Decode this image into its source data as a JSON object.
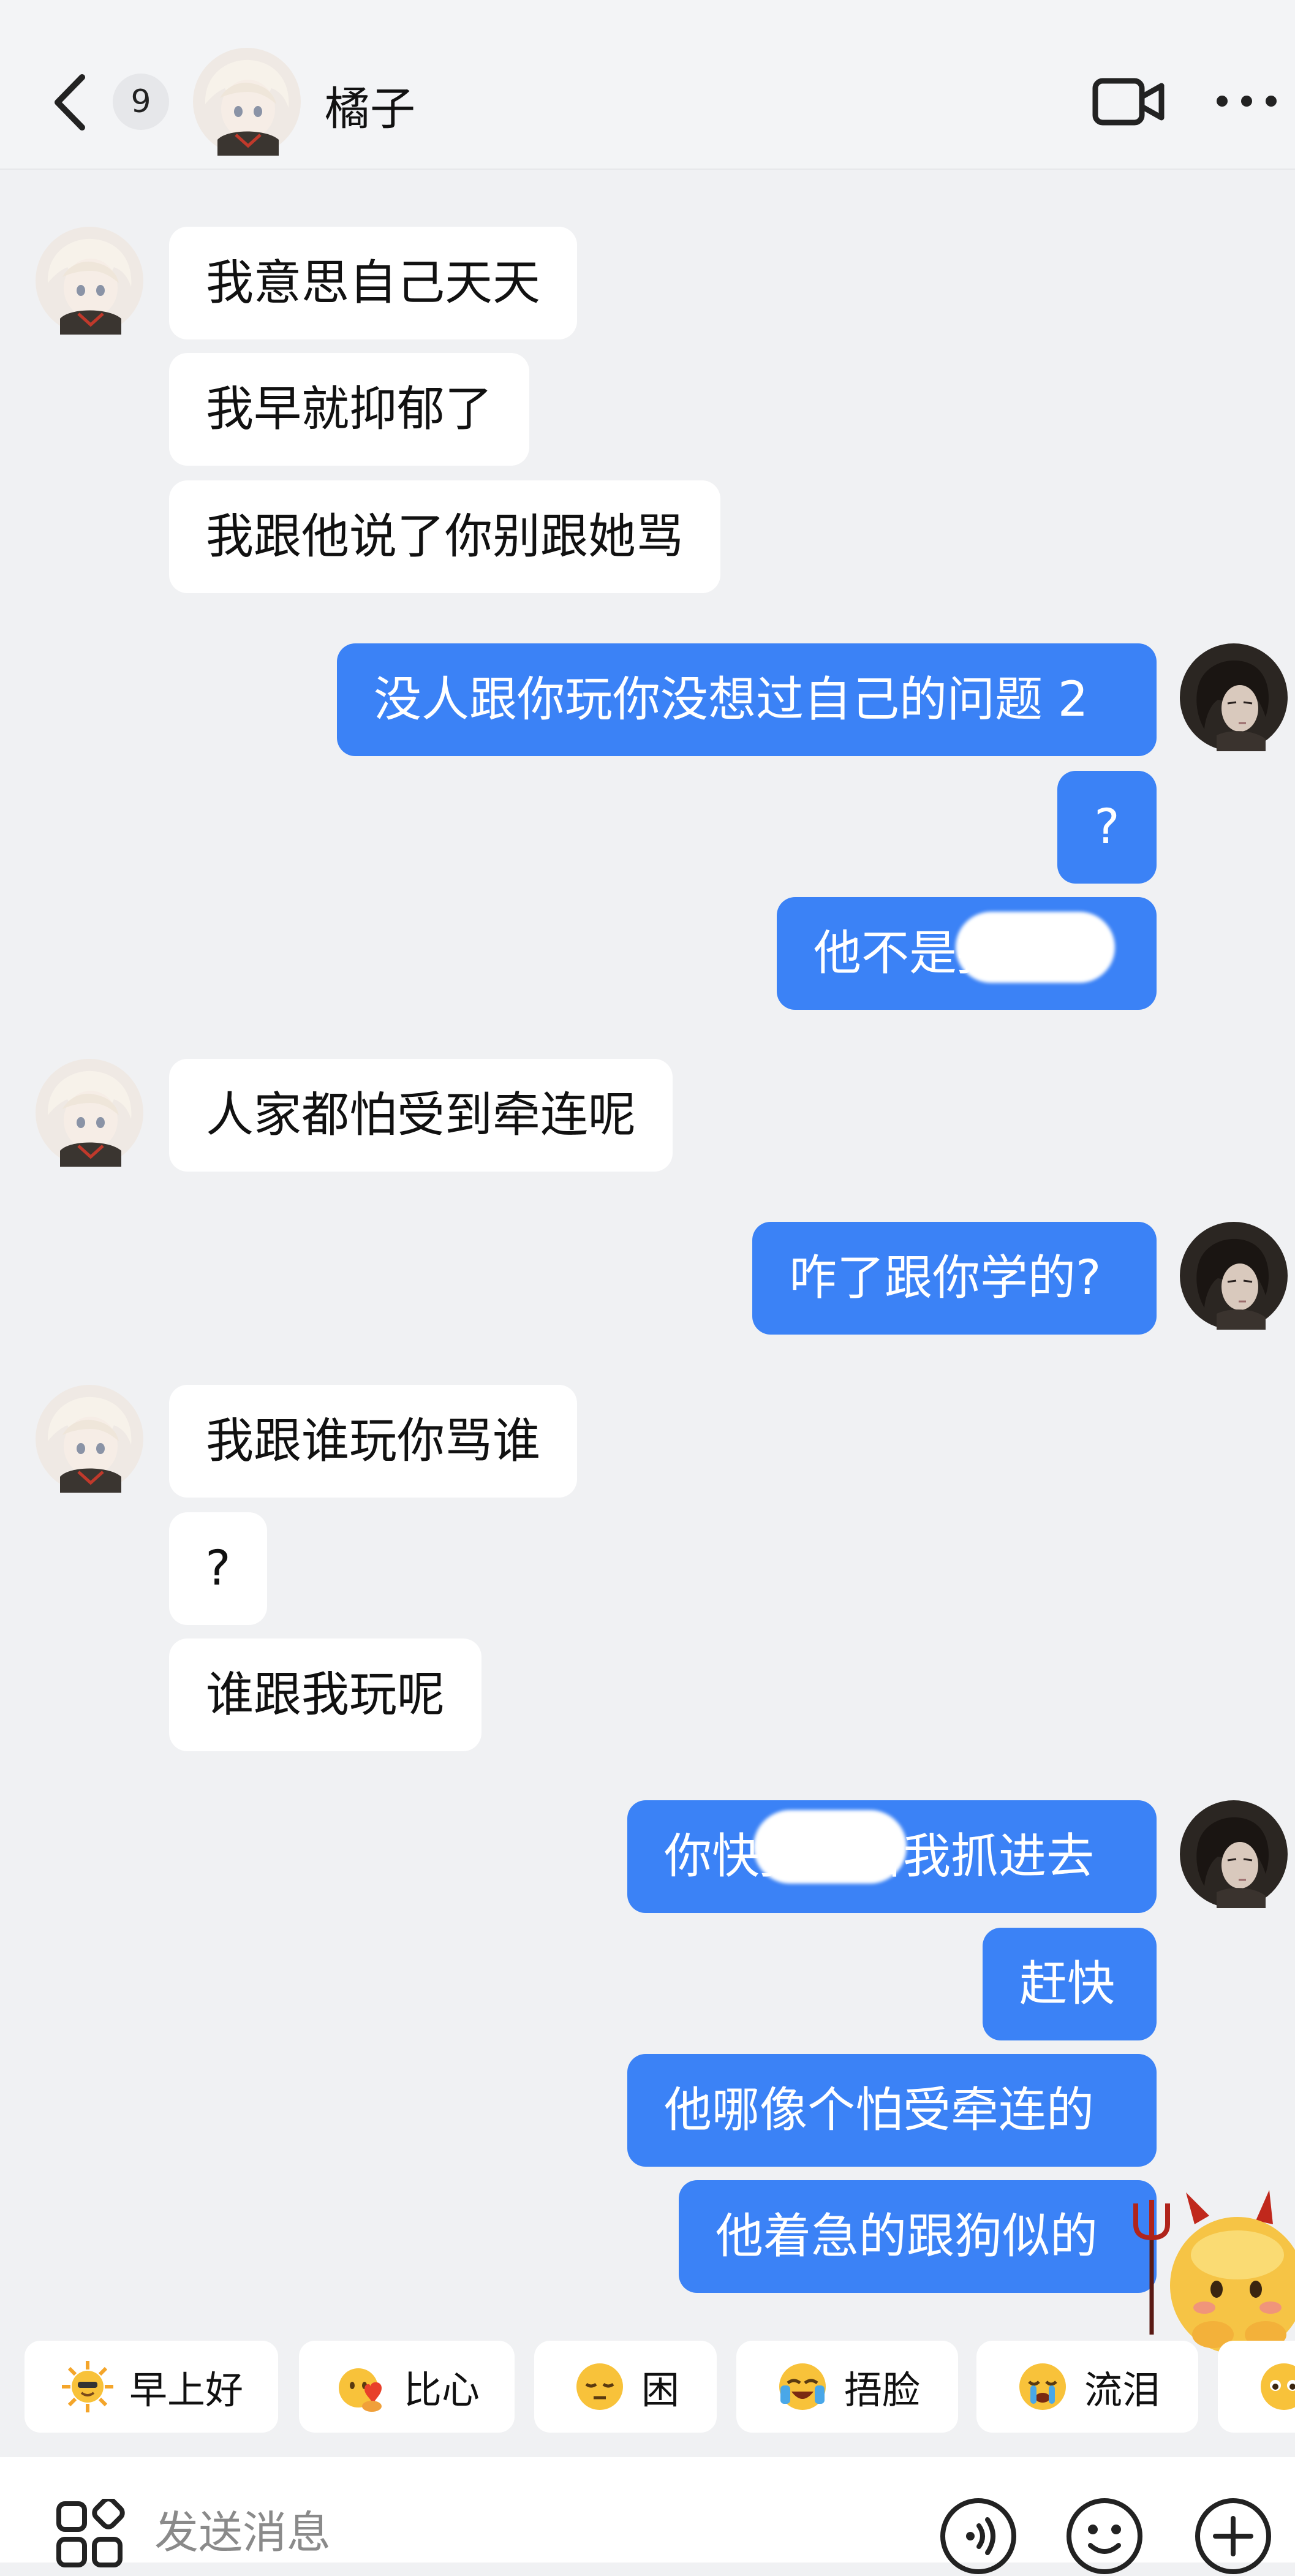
{
  "header": {
    "unread_count": "9",
    "contact_name": "橘子"
  },
  "messages": [
    {
      "side": "in",
      "text": "我意思自己天天"
    },
    {
      "side": "in",
      "text": "我早就抑郁了"
    },
    {
      "side": "in",
      "text": "我跟他说了你别跟她骂"
    },
    {
      "side": "out",
      "text": "没人跟你玩你没想过自己的问题 2"
    },
    {
      "side": "out",
      "text": "?"
    },
    {
      "side": "out",
      "text": "他不是报警呢"
    },
    {
      "side": "in",
      "text": "人家都怕受到牵连呢"
    },
    {
      "side": "out",
      "text": "咋了跟你学的?"
    },
    {
      "side": "in",
      "text": "我跟谁玩你骂谁"
    },
    {
      "side": "in",
      "text": "?"
    },
    {
      "side": "in",
      "text": "谁跟我玩呢"
    },
    {
      "side": "out",
      "text": "你快报警给我抓进去"
    },
    {
      "side": "out",
      "text": "赶快"
    },
    {
      "side": "out",
      "text": "他哪像个怕受牵连的"
    },
    {
      "side": "out",
      "text": "他着急的跟狗似的"
    }
  ],
  "quick_replies": [
    {
      "label": "早上好",
      "icon": "sun-face-emoji"
    },
    {
      "label": "比心",
      "icon": "heart-hands-emoji"
    },
    {
      "label": "困",
      "icon": "sleepy-face-emoji"
    },
    {
      "label": "捂脸",
      "icon": "facepalm-emoji"
    },
    {
      "label": "流泪",
      "icon": "crying-face-emoji"
    }
  ],
  "input": {
    "placeholder": "发送消息"
  },
  "colors": {
    "outgoing_bubble": "#3b82f6",
    "incoming_bubble": "#ffffff",
    "background": "#f0f1f3"
  }
}
